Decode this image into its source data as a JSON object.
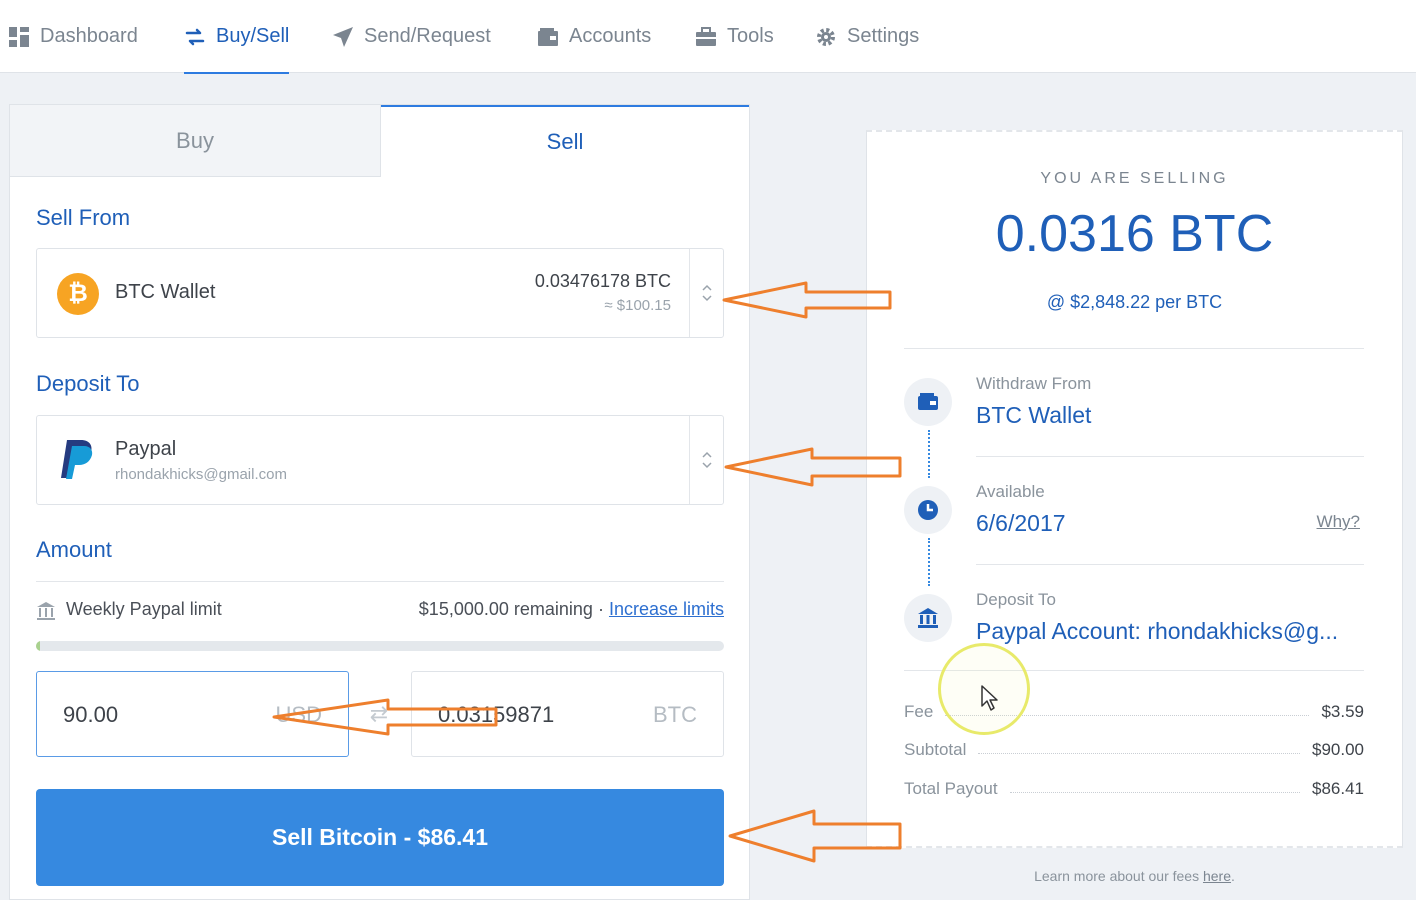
{
  "nav": {
    "items": [
      {
        "label": "Dashboard",
        "icon": "dashboard-icon"
      },
      {
        "label": "Buy/Sell",
        "icon": "swap-arrows-icon",
        "active": true
      },
      {
        "label": "Send/Request",
        "icon": "paper-plane-icon"
      },
      {
        "label": "Accounts",
        "icon": "wallet-icon"
      },
      {
        "label": "Tools",
        "icon": "briefcase-icon"
      },
      {
        "label": "Settings",
        "icon": "gear-icon"
      }
    ]
  },
  "tabs": {
    "buy": "Buy",
    "sell": "Sell",
    "active": "Sell"
  },
  "sell_from": {
    "label": "Sell From",
    "wallet_name": "BTC Wallet",
    "balance_btc": "0.03476178 BTC",
    "balance_usd": "≈ $100.15"
  },
  "deposit_to": {
    "label": "Deposit To",
    "method": "Paypal",
    "email": "rhondakhicks@gmail.com"
  },
  "amount": {
    "label": "Amount",
    "limit_label": "Weekly Paypal limit",
    "remaining": "$15,000.00 remaining",
    "separator": "·",
    "increase_link": "Increase limits",
    "limit_used_fraction": 0.006,
    "usd_value": "90.00",
    "usd_unit": "USD",
    "btc_value": "0.03159871",
    "btc_unit": "BTC"
  },
  "sell_button": "Sell Bitcoin - $86.41",
  "summary": {
    "eyebrow": "YOU ARE SELLING",
    "amount": "0.0316 BTC",
    "rate": "@ $2,848.22 per BTC",
    "withdraw_label": "Withdraw From",
    "withdraw_value": "BTC Wallet",
    "available_label": "Available",
    "available_value": "6/6/2017",
    "why_link": "Why?",
    "deposit_label": "Deposit To",
    "deposit_value": "Paypal Account: rhondakhicks@g...",
    "fees": [
      {
        "label": "Fee",
        "value": "$3.59"
      },
      {
        "label": "Subtotal",
        "value": "$90.00"
      },
      {
        "label": "Total Payout",
        "value": "$86.41"
      }
    ],
    "footnote_text": "Learn more about our fees ",
    "footnote_link": "here",
    "footnote_end": "."
  },
  "colors": {
    "accent": "#1f5fb8",
    "button": "#3689e0",
    "annotation_arrow": "#ee7f2d",
    "cursor_highlight": "#e8ea6a"
  }
}
